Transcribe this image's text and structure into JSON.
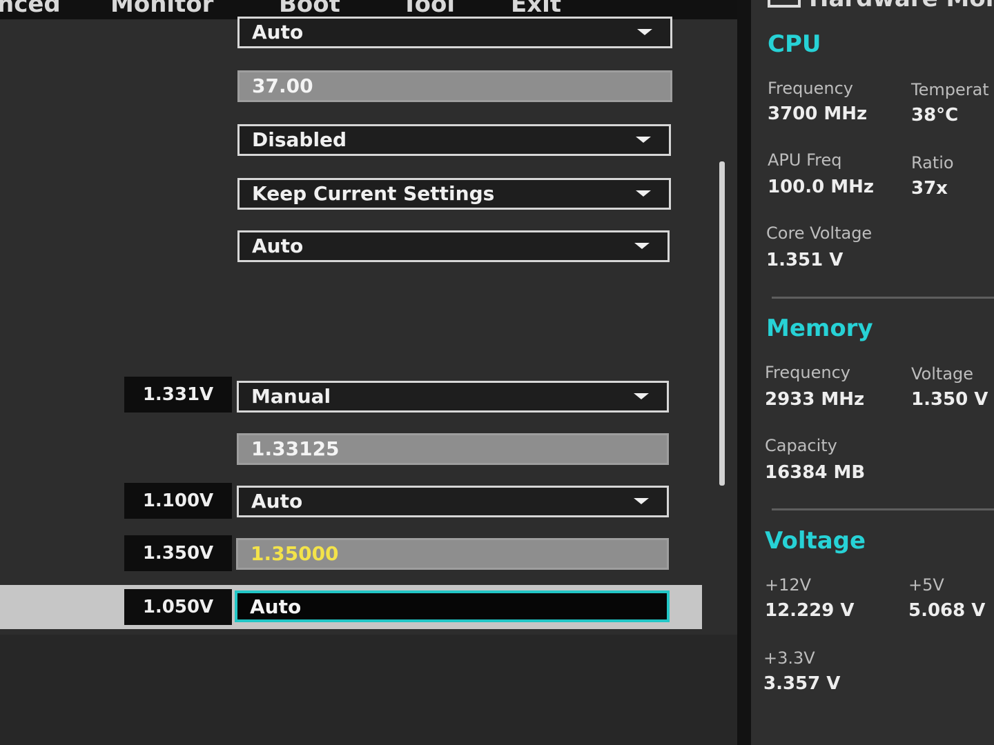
{
  "menu": {
    "items": [
      "nced",
      "Monitor",
      "Boot",
      "Tool",
      "Exit"
    ]
  },
  "settings": {
    "rows": [
      {
        "voltage": "",
        "value": "Auto",
        "kind": "dropdown"
      },
      {
        "voltage": "",
        "value": "37.00",
        "kind": "textbox"
      },
      {
        "voltage": "",
        "value": "Disabled",
        "kind": "dropdown"
      },
      {
        "voltage": "",
        "value": "Keep Current Settings",
        "kind": "dropdown"
      },
      {
        "voltage": "",
        "value": "Auto",
        "kind": "dropdown"
      },
      {
        "voltage": "1.331V",
        "value": "Manual",
        "kind": "dropdown"
      },
      {
        "voltage": "",
        "value": "1.33125",
        "kind": "textbox"
      },
      {
        "voltage": "1.100V",
        "value": "Auto",
        "kind": "dropdown"
      },
      {
        "voltage": "1.350V",
        "value": "1.35000",
        "kind": "textbox",
        "highlight_color": "#f3e34a"
      },
      {
        "voltage": "1.050V",
        "value": "Auto",
        "kind": "selected",
        "selected": true
      }
    ]
  },
  "hardware_monitor": {
    "title": "Hardware Moni",
    "cpu": {
      "heading": "CPU",
      "frequency_label": "Frequency",
      "frequency_value": "3700 MHz",
      "temperature_label": "Temperat",
      "temperature_value": "38°C",
      "apu_freq_label": "APU Freq",
      "apu_freq_value": "100.0 MHz",
      "ratio_label": "Ratio",
      "ratio_value": "37x",
      "core_voltage_label": "Core Voltage",
      "core_voltage_value": "1.351 V"
    },
    "memory": {
      "heading": "Memory",
      "frequency_label": "Frequency",
      "frequency_value": "2933 MHz",
      "voltage_label": "Voltage",
      "voltage_value": "1.350 V",
      "capacity_label": "Capacity",
      "capacity_value": "16384 MB"
    },
    "voltage": {
      "heading": "Voltage",
      "v12_label": "+12V",
      "v12_value": "12.229 V",
      "v5_label": "+5V",
      "v5_value": "5.068 V",
      "v33_label": "+3.3V",
      "v33_value": "3.357 V"
    }
  },
  "colors": {
    "accent": "#27d2d6",
    "highlight_value": "#f3e34a"
  }
}
